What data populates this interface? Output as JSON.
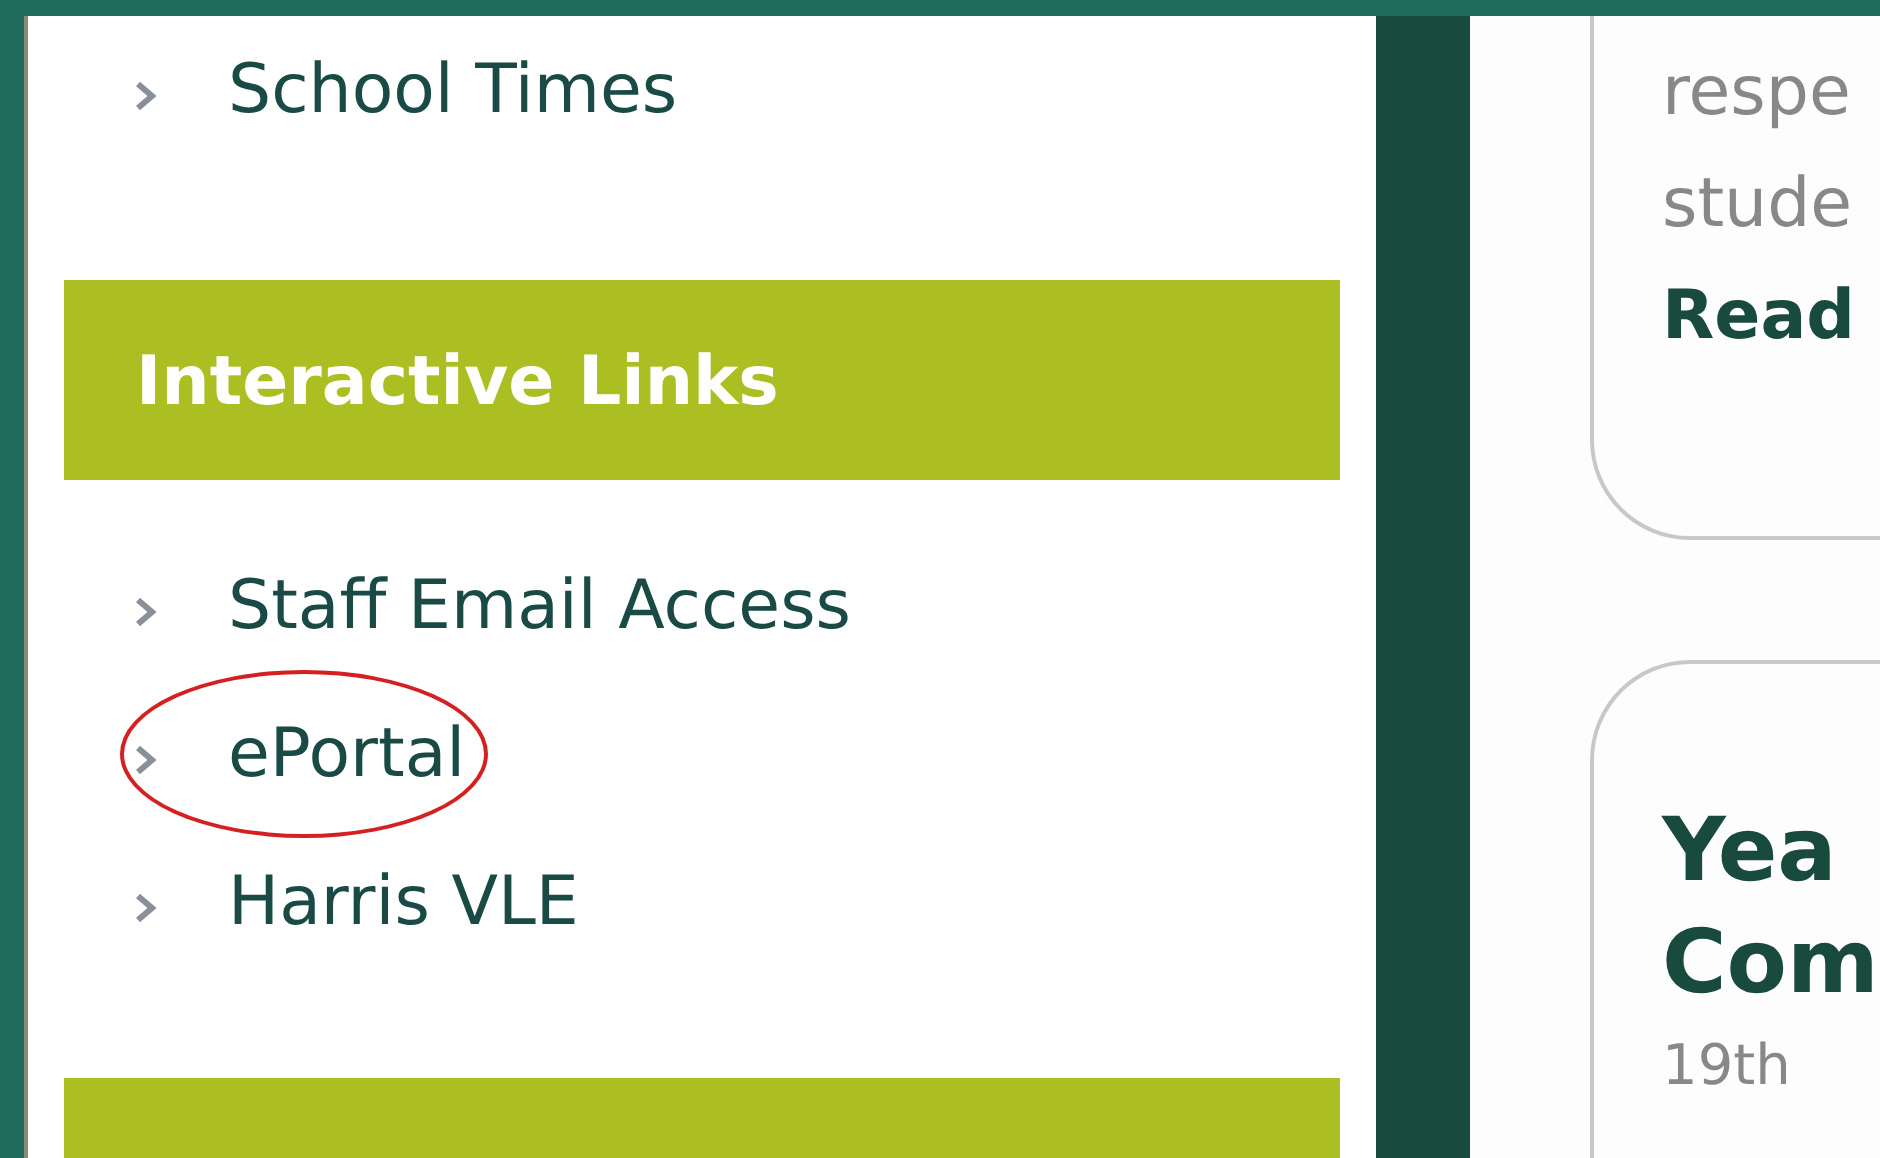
{
  "sidebar": {
    "top_links": [
      {
        "label": "School Times",
        "highlighted": false
      }
    ],
    "sections": [
      {
        "heading": "Interactive Links",
        "links": [
          {
            "label": "Staff Email Access",
            "highlighted": false
          },
          {
            "label": "ePortal",
            "highlighted": true
          },
          {
            "label": "Harris VLE",
            "highlighted": false
          }
        ]
      }
    ]
  },
  "content": {
    "cards": [
      {
        "lines": [
          "respe",
          "stude"
        ],
        "link": "Read"
      },
      {
        "title_lines": [
          "Yea",
          "Com"
        ],
        "date": "19th"
      }
    ]
  }
}
